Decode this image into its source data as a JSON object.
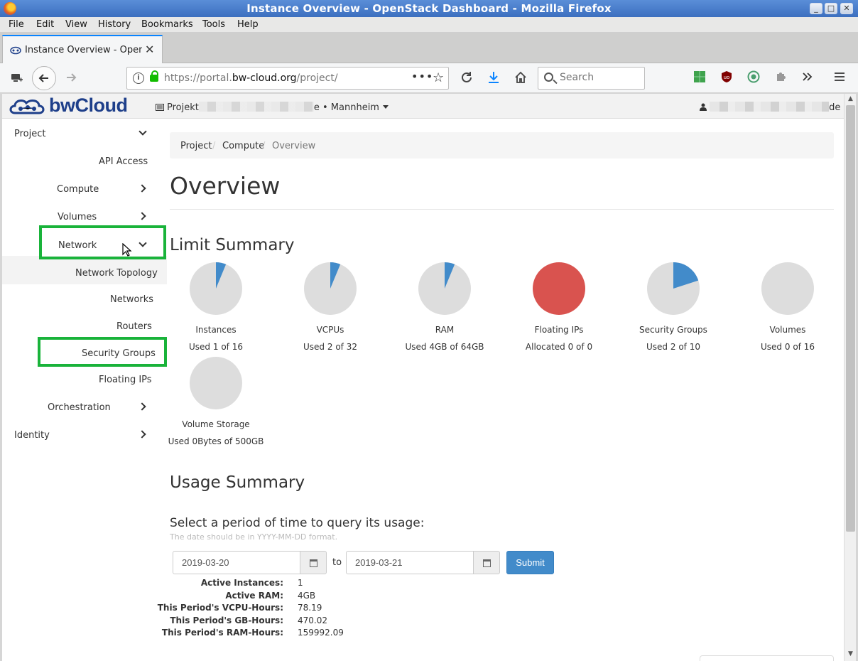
{
  "window": {
    "title": "Instance Overview - OpenStack Dashboard - Mozilla Firefox",
    "buttons": [
      "_",
      "□",
      "✕"
    ]
  },
  "menubar": [
    "File",
    "Edit",
    "View",
    "History",
    "Bookmarks",
    "Tools",
    "Help"
  ],
  "tab": {
    "title": "Instance Overview - OpenStack Dashboard",
    "close": "✕"
  },
  "navbar": {
    "url_prefix": "https://portal.",
    "url_domain": "bw-cloud.org",
    "url_path": "/project/",
    "search_placeholder": "Search"
  },
  "app": {
    "logo_text": "bwCloud",
    "project_prefix": "Projekt",
    "project_suffix": "e • Mannheim",
    "user_suffix": "de"
  },
  "sidebar": {
    "project": "Project",
    "api_access": "API Access",
    "compute": "Compute",
    "volumes": "Volumes",
    "network": "Network",
    "network_topology": "Network Topology",
    "networks": "Networks",
    "routers": "Routers",
    "security_groups": "Security Groups",
    "floating_ips": "Floating IPs",
    "orchestration": "Orchestration",
    "identity": "Identity"
  },
  "breadcrumb": [
    "Project",
    "Compute",
    "Overview"
  ],
  "page_title": "Overview",
  "limit_summary": {
    "heading": "Limit Summary",
    "colors": {
      "used": "#428bca",
      "free": "#dddddd",
      "full": "#d9534f"
    },
    "items": [
      {
        "label": "Instances",
        "text": "Used 1 of 16",
        "used": 1,
        "total": 16
      },
      {
        "label": "VCPUs",
        "text": "Used 2 of 32",
        "used": 2,
        "total": 32
      },
      {
        "label": "RAM",
        "text": "Used 4GB of 64GB",
        "used": 4,
        "total": 64
      },
      {
        "label": "Floating IPs",
        "text": "Allocated 0 of 0",
        "used": 0,
        "total": 0
      },
      {
        "label": "Security Groups",
        "text": "Used 2 of 10",
        "used": 2,
        "total": 10
      },
      {
        "label": "Volumes",
        "text": "Used 0 of 16",
        "used": 0,
        "total": 16
      },
      {
        "label": "Volume Storage",
        "text": "Used 0Bytes of 500GB",
        "used": 0,
        "total": 500
      }
    ]
  },
  "usage_summary": {
    "heading": "Usage Summary",
    "period_label": "Select a period of time to query its usage:",
    "help_text": "The date should be in YYYY-MM-DD format.",
    "start_date": "2019-03-20",
    "to_label": "to",
    "end_date": "2019-03-21",
    "submit_label": "Submit",
    "stats": [
      {
        "key": "Active Instances:",
        "value": "1"
      },
      {
        "key": "Active RAM:",
        "value": "4GB"
      },
      {
        "key": "This Period's VCPU-Hours:",
        "value": "78.19"
      },
      {
        "key": "This Period's GB-Hours:",
        "value": "470.02"
      },
      {
        "key": "This Period's RAM-Hours:",
        "value": "159992.09"
      }
    ]
  }
}
